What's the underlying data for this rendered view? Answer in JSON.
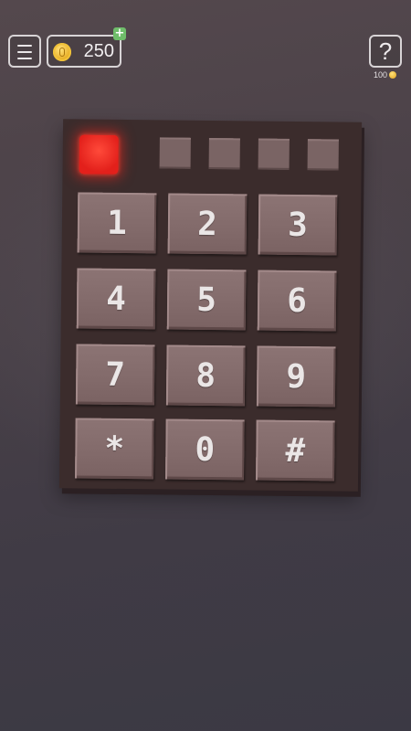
{
  "top_bar": {
    "coins": "250",
    "add_coins_symbol": "+",
    "hint_symbol": "?",
    "hint_cost": "100"
  },
  "keypad": {
    "indicators": [
      {
        "state": "active"
      },
      {
        "state": "off"
      },
      {
        "state": "off"
      },
      {
        "state": "off"
      },
      {
        "state": "off"
      }
    ],
    "keys": [
      "1",
      "2",
      "3",
      "4",
      "5",
      "6",
      "7",
      "8",
      "9",
      "*",
      "0",
      "#"
    ]
  },
  "colors": {
    "indicator_active": "#e3201b",
    "key_face": "#826a6a",
    "panel": "#3b2c2c"
  }
}
